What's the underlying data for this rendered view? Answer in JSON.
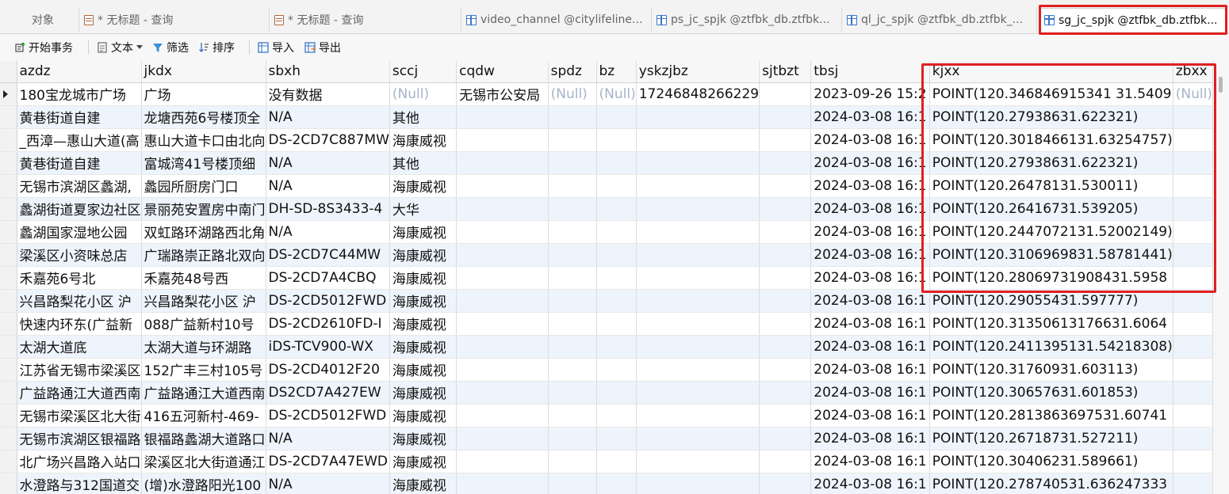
{
  "tabs": [
    {
      "label": "对象",
      "icon": "none",
      "active": false
    },
    {
      "label": "* 无标题 - 查询",
      "icon": "query-icon",
      "active": false
    },
    {
      "label": "* 无标题 - 查询",
      "icon": "query-icon",
      "active": false
    },
    {
      "label": "video_channel @citylifeline...",
      "icon": "table-icon",
      "active": false
    },
    {
      "label": "ps_jc_spjk @ztfbk_db.ztfbk...",
      "icon": "table-icon",
      "active": false
    },
    {
      "label": "ql_jc_spjk @ztfbk_db.ztfbk_...",
      "icon": "table-icon",
      "active": false
    },
    {
      "label": "sg_jc_spjk @ztfbk_db.ztfbk...",
      "icon": "table-icon",
      "active": true
    }
  ],
  "toolbar": {
    "begin_transaction": "开始事务",
    "text": "文本",
    "filter": "筛选",
    "sort": "排序",
    "import": "导入",
    "export": "导出"
  },
  "columns": [
    "azdz",
    "jkdx",
    "sbxh",
    "sccj",
    "cqdw",
    "spdz",
    "bz",
    "yskzjbz",
    "sjtbzt",
    "tbsj",
    "kjxx",
    "zbxx"
  ],
  "rows": [
    [
      "180宝龙城市广场",
      "广场",
      "没有数据",
      "(Null)",
      "无锡市公安局",
      "(Null)",
      "(Null)",
      "17246848266229",
      "",
      "2023-09-26 15:2",
      "POINT(120.346846915341 31.5409",
      "(Null)"
    ],
    [
      "黄巷街道自建",
      "龙塘西苑6号楼顶全",
      "N/A",
      "其他",
      "",
      "",
      "",
      "",
      "",
      "2024-03-08 16:1",
      "POINT(120.27938631.622321)",
      ""
    ],
    [
      "_西漳—惠山大道(高",
      "惠山大道卡口由北向",
      "DS-2CD7C887MW",
      "海康威视",
      "",
      "",
      "",
      "",
      "",
      "2024-03-08 16:1",
      "POINT(120.3018466131.63254757)",
      ""
    ],
    [
      "黄巷街道自建",
      "富城湾41号楼顶细",
      "N/A",
      "其他",
      "",
      "",
      "",
      "",
      "",
      "2024-03-08 16:1",
      "POINT(120.27938631.622321)",
      ""
    ],
    [
      "无锡市滨湖区蠡湖,",
      "蠡园所厨房门口",
      "N/A",
      "海康威视",
      "",
      "",
      "",
      "",
      "",
      "2024-03-08 16:1",
      "POINT(120.26478131.530011)",
      ""
    ],
    [
      "蠡湖街道夏家边社区",
      "景丽苑安置房中南门",
      "DH-SD-8S3433-4",
      "大华",
      "",
      "",
      "",
      "",
      "",
      "2024-03-08 16:1",
      "POINT(120.26416731.539205)",
      ""
    ],
    [
      "蠡湖国家湿地公园",
      "双虹路环湖路西北角",
      "N/A",
      "海康威视",
      "",
      "",
      "",
      "",
      "",
      "2024-03-08 16:1",
      "POINT(120.2447072131.52002149)",
      ""
    ],
    [
      "梁溪区小资味总店",
      "广瑞路崇正路北双向",
      "DS-2CD7C44MW",
      "海康威视",
      "",
      "",
      "",
      "",
      "",
      "2024-03-08 16:1",
      "POINT(120.3106969831.58781441)",
      ""
    ],
    [
      "禾嘉苑6号北",
      "禾嘉苑48号西",
      "DS-2CD7A4CBQ",
      "海康威视",
      "",
      "",
      "",
      "",
      "",
      "2024-03-08 16:1",
      "POINT(120.28069731908431.5958",
      ""
    ],
    [
      "兴昌路梨花小区 沪",
      "兴昌路梨花小区 沪",
      "DS-2CD5012FWD",
      "海康威视",
      "",
      "",
      "",
      "",
      "",
      "2024-03-08 16:1",
      "POINT(120.29055431.597777)",
      ""
    ],
    [
      "快速内环东(广益新",
      "088广益新村10号",
      "DS-2CD2610FD-I",
      "海康威视",
      "",
      "",
      "",
      "",
      "",
      "2024-03-08 16:1",
      "POINT(120.31350613176631.6064",
      ""
    ],
    [
      "太湖大道底",
      "太湖大道与环湖路",
      "iDS-TCV900-WX",
      "海康威视",
      "",
      "",
      "",
      "",
      "",
      "2024-03-08 16:1",
      "POINT(120.2411395131.54218308)",
      ""
    ],
    [
      "江苏省无锡市梁溪区",
      "152广丰三村105号",
      "DS-2CD4012F20",
      "海康威视",
      "",
      "",
      "",
      "",
      "",
      "2024-03-08 16:1",
      "POINT(120.31760931.603113)",
      ""
    ],
    [
      "广益路通江大道西南",
      "广益路通江大道西南",
      "DS2CD7A427EW",
      "海康威视",
      "",
      "",
      "",
      "",
      "",
      "2024-03-08 16:1",
      "POINT(120.30657631.601853)",
      ""
    ],
    [
      "无锡市梁溪区北大街",
      "416五河新村-469-",
      "DS-2CD5012FWD",
      "海康威视",
      "",
      "",
      "",
      "",
      "",
      "2024-03-08 16:1",
      "POINT(120.2813863697531.60741",
      ""
    ],
    [
      "无锡市滨湖区银福路",
      "银福路蠡湖大道路口",
      "N/A",
      "海康威视",
      "",
      "",
      "",
      "",
      "",
      "2024-03-08 16:1",
      "POINT(120.26718731.527211)",
      ""
    ],
    [
      "北广场兴昌路入站口",
      "梁溪区北大街道通江",
      "DS-2CD7A47EWD",
      "海康威视",
      "",
      "",
      "",
      "",
      "",
      "2024-03-08 16:1",
      "POINT(120.30406231.589661)",
      ""
    ],
    [
      "水澄路与312国道交",
      "(增)水澄路阳光100",
      "N/A",
      "海康威视",
      "",
      "",
      "",
      "",
      "",
      "2024-03-08 16:1",
      "POINT(120.278740531.636247333",
      ""
    ]
  ],
  "colors": {
    "highlight": "#e02020",
    "null_text": "#a6b4c8",
    "alt_row": "#eef4fb"
  }
}
